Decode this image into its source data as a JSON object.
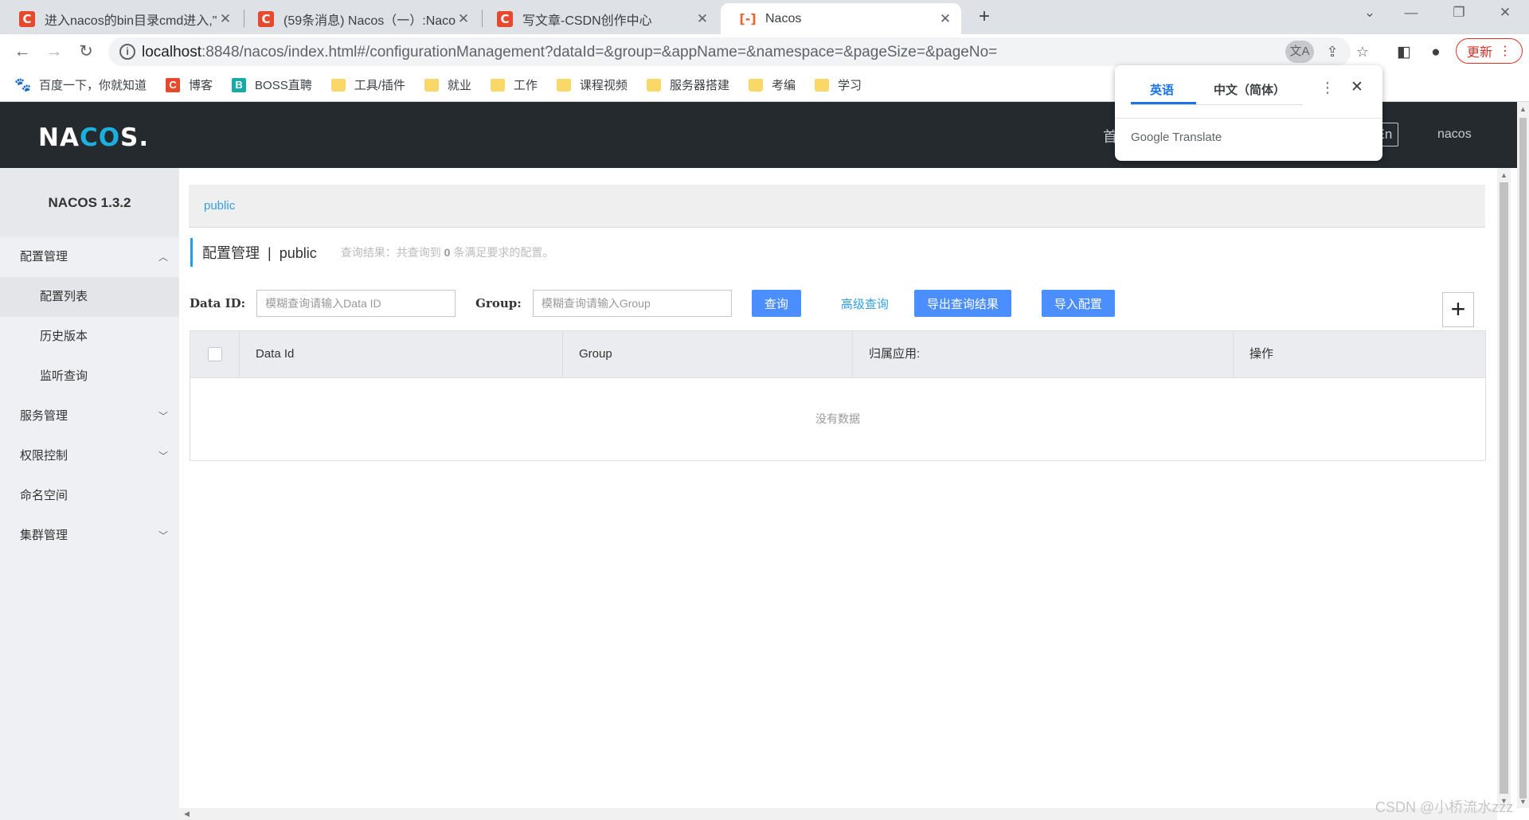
{
  "browser": {
    "tabs": [
      {
        "title": "进入nacos的bin目录cmd进入,\"..."
      },
      {
        "title": "(59条消息) Nacos（一）:Nacos..."
      },
      {
        "title": "写文章-CSDN创作中心"
      },
      {
        "title": "Nacos"
      }
    ],
    "url_host": "localhost",
    "url_rest": ":8848/nacos/index.html#/configurationManagement?dataId=&group=&appName=&namespace=&pageSize=&pageNo=",
    "update_label": "更新",
    "bookmarks": [
      "百度一下，你就知道",
      "博客",
      "BOSS直聘",
      "工具/插件",
      "就业",
      "工作",
      "课程视频",
      "服务器搭建",
      "考编",
      "学习"
    ]
  },
  "translate_popup": {
    "lang_source": "英语",
    "lang_target": "中文（简体）",
    "brand": "Google",
    "product": "Translate"
  },
  "header": {
    "logo_a": "NA",
    "logo_b": "CO",
    "logo_c": "S.",
    "nav_partial": "首",
    "lang_partial": "En",
    "user": "nacos"
  },
  "sidebar": {
    "title": "NACOS 1.3.2",
    "groups": [
      {
        "label": "配置管理",
        "children": [
          "配置列表",
          "历史版本",
          "监听查询"
        ]
      },
      {
        "label": "服务管理"
      },
      {
        "label": "权限控制"
      },
      {
        "label": "命名空间"
      },
      {
        "label": "集群管理"
      }
    ]
  },
  "main": {
    "namespace_tab": "public",
    "page_title": "配置管理",
    "page_sep": "|",
    "page_ns": "public",
    "result_prefix": "查询结果：共查询到",
    "result_count": "0",
    "result_suffix": "条满足要求的配置。",
    "filter": {
      "dataid_label": "Data ID:",
      "dataid_placeholder": "模糊查询请输入Data ID",
      "group_label": "Group:",
      "group_placeholder": "模糊查询请输入Group",
      "query_button": "查询",
      "advanced_link": "高级查询",
      "export_button": "导出查询结果",
      "import_button": "导入配置",
      "add_symbol": "+"
    },
    "table": {
      "columns": [
        "Data Id",
        "Group",
        "归属应用:",
        "操作"
      ],
      "empty_text": "没有数据"
    }
  },
  "watermark": "CSDN @小桥流水zzz"
}
